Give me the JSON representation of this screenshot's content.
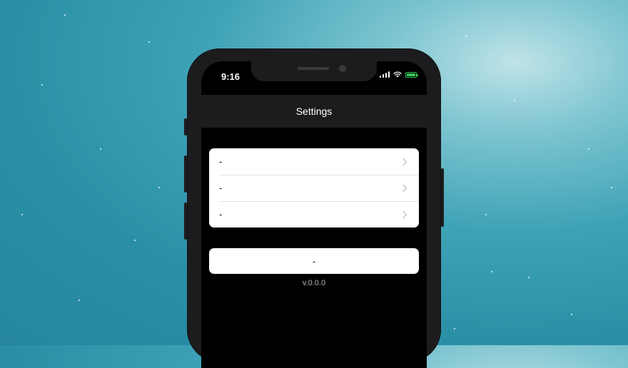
{
  "status_bar": {
    "time": "9:16"
  },
  "navbar": {
    "title": "Settings"
  },
  "settings_list": {
    "items": [
      {
        "label": "-"
      },
      {
        "label": "-"
      },
      {
        "label": "-"
      }
    ]
  },
  "action_button": {
    "label": "-"
  },
  "footer": {
    "version": "v.0.0.0"
  },
  "icons": {
    "signal": "cellular-signal-icon",
    "wifi": "wifi-icon",
    "battery": "battery-charging-icon",
    "chevron": "chevron-right-icon"
  },
  "colors": {
    "background": "#2a8fa6",
    "phone_frame": "#1c1c1e",
    "screen": "#000000",
    "battery": "#34c759",
    "card": "#ffffff"
  }
}
